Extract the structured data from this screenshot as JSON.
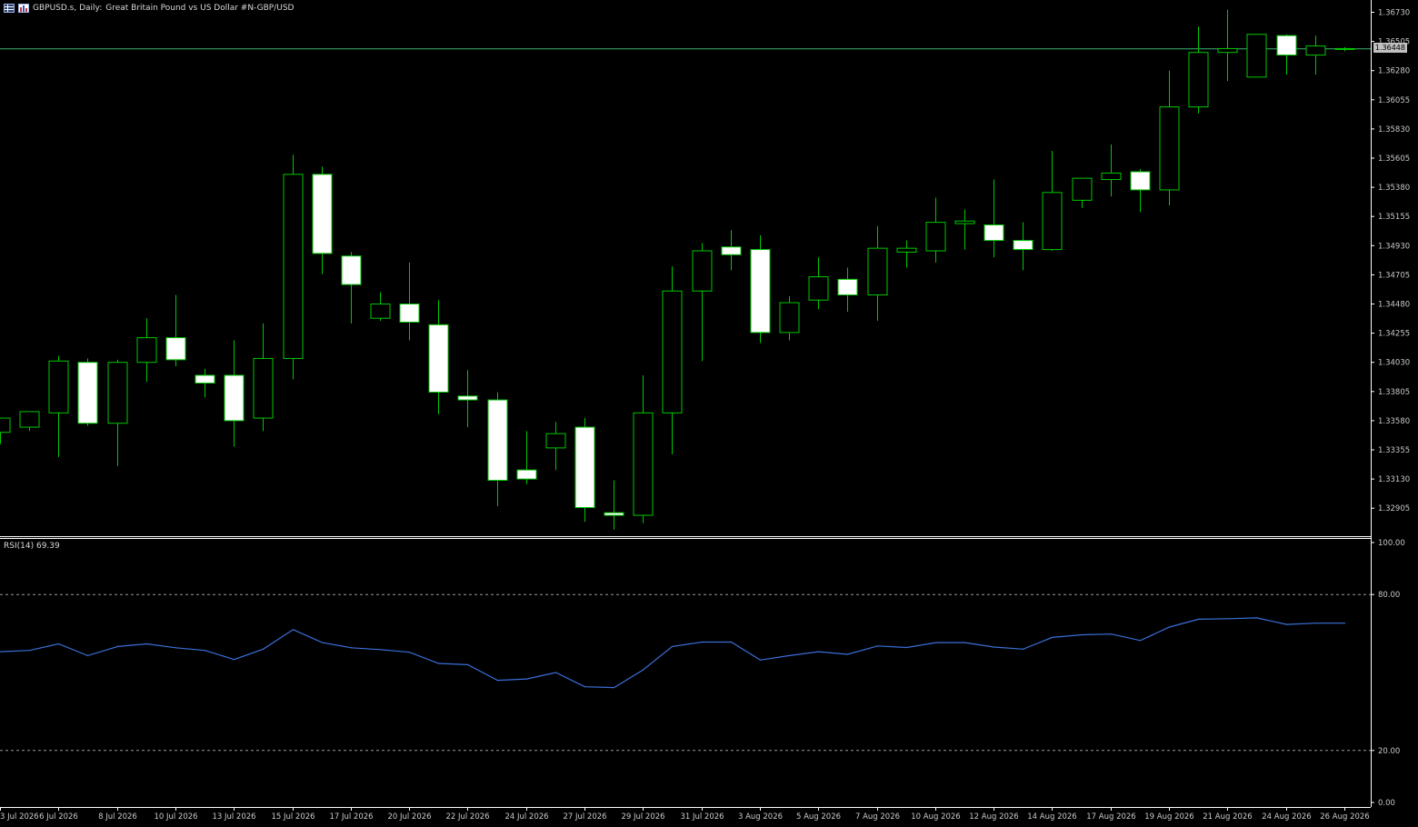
{
  "header": {
    "symbol": "GBPUSD.s, Daily:",
    "description": "Great Britain Pound vs US Dollar #N-GBP/USD",
    "icons": [
      "menu-grid-icon",
      "bar-chart-icon"
    ]
  },
  "rsi_header": {
    "label": "RSI(14)",
    "value": "69.39"
  },
  "current_price_tag": "1.36448",
  "colors": {
    "background": "#000000",
    "candle_outline": "#00c800",
    "bull_body": "#000000",
    "bear_body": "#ffffff",
    "rsi_line": "#3a6fd8",
    "bid_line": "#3cb371",
    "axis": "#ffffff",
    "text": "#c8c8c8"
  },
  "chart_data": [
    {
      "type": "candlestick",
      "title": "GBPUSD.s, Daily:  Great Britain Pound vs US Dollar #N-GBP/USD",
      "price_axis_ticks": [
        "1.36730",
        "1.36505",
        "1.36280",
        "1.36055",
        "1.35830",
        "1.35605",
        "1.35380",
        "1.35155",
        "1.34930",
        "1.34705",
        "1.34480",
        "1.34255",
        "1.34030",
        "1.33805",
        "1.33580",
        "1.33355",
        "1.33130",
        "1.32905"
      ],
      "ylim": [
        1.3275,
        1.368
      ],
      "date_axis_labels": [
        "3 Jul 2026",
        "6 Jul 2026",
        "8 Jul 2026",
        "10 Jul 2026",
        "13 Jul 2026",
        "15 Jul 2026",
        "17 Jul 2026",
        "20 Jul 2026",
        "22 Jul 2026",
        "24 Jul 2026",
        "27 Jul 2026",
        "29 Jul 2026",
        "31 Jul 2026",
        "3 Aug 2026",
        "5 Aug 2026",
        "7 Aug 2026",
        "10 Aug 2026",
        "12 Aug 2026",
        "14 Aug 2026",
        "17 Aug 2026",
        "19 Aug 2026",
        "21 Aug 2026",
        "24 Aug 2026",
        "26 Aug 2026"
      ],
      "bid_line": 1.36448,
      "candles": [
        {
          "o": 1.3349,
          "h": 1.336,
          "l": 1.334,
          "c": 1.336
        },
        {
          "o": 1.3353,
          "h": 1.3365,
          "l": 1.335,
          "c": 1.3365
        },
        {
          "o": 1.3364,
          "h": 1.3408,
          "l": 1.333,
          "c": 1.3404
        },
        {
          "o": 1.3403,
          "h": 1.3406,
          "l": 1.3354,
          "c": 1.3356
        },
        {
          "o": 1.3356,
          "h": 1.3405,
          "l": 1.3323,
          "c": 1.3403
        },
        {
          "o": 1.3403,
          "h": 1.3437,
          "l": 1.3388,
          "c": 1.3422
        },
        {
          "o": 1.3422,
          "h": 1.3455,
          "l": 1.34,
          "c": 1.3405
        },
        {
          "o": 1.3393,
          "h": 1.3398,
          "l": 1.3376,
          "c": 1.3387
        },
        {
          "o": 1.3393,
          "h": 1.342,
          "l": 1.3338,
          "c": 1.3358
        },
        {
          "o": 1.336,
          "h": 1.3433,
          "l": 1.335,
          "c": 1.3406
        },
        {
          "o": 1.3406,
          "h": 1.3563,
          "l": 1.339,
          "c": 1.3548
        },
        {
          "o": 1.3548,
          "h": 1.3554,
          "l": 1.3471,
          "c": 1.3487
        },
        {
          "o": 1.3485,
          "h": 1.3488,
          "l": 1.3433,
          "c": 1.3463
        },
        {
          "o": 1.3437,
          "h": 1.3457,
          "l": 1.3435,
          "c": 1.3448
        },
        {
          "o": 1.3448,
          "h": 1.348,
          "l": 1.342,
          "c": 1.3434
        },
        {
          "o": 1.3432,
          "h": 1.3451,
          "l": 1.3363,
          "c": 1.338
        },
        {
          "o": 1.3377,
          "h": 1.3397,
          "l": 1.3353,
          "c": 1.3374
        },
        {
          "o": 1.3374,
          "h": 1.338,
          "l": 1.3292,
          "c": 1.3312
        },
        {
          "o": 1.332,
          "h": 1.335,
          "l": 1.3309,
          "c": 1.3313
        },
        {
          "o": 1.3337,
          "h": 1.3357,
          "l": 1.332,
          "c": 1.3348
        },
        {
          "o": 1.3353,
          "h": 1.336,
          "l": 1.328,
          "c": 1.3291
        },
        {
          "o": 1.3287,
          "h": 1.3312,
          "l": 1.3274,
          "c": 1.3285
        },
        {
          "o": 1.3285,
          "h": 1.3393,
          "l": 1.3279,
          "c": 1.3364
        },
        {
          "o": 1.3364,
          "h": 1.3477,
          "l": 1.3332,
          "c": 1.3458
        },
        {
          "o": 1.3458,
          "h": 1.3495,
          "l": 1.3404,
          "c": 1.3489
        },
        {
          "o": 1.3492,
          "h": 1.3505,
          "l": 1.3474,
          "c": 1.3486
        },
        {
          "o": 1.349,
          "h": 1.3501,
          "l": 1.3418,
          "c": 1.3426
        },
        {
          "o": 1.3426,
          "h": 1.3454,
          "l": 1.342,
          "c": 1.3449
        },
        {
          "o": 1.3451,
          "h": 1.3484,
          "l": 1.3444,
          "c": 1.3469
        },
        {
          "o": 1.3467,
          "h": 1.3476,
          "l": 1.3442,
          "c": 1.3455
        },
        {
          "o": 1.3455,
          "h": 1.3508,
          "l": 1.3435,
          "c": 1.3491
        },
        {
          "o": 1.3488,
          "h": 1.3497,
          "l": 1.3476,
          "c": 1.3491
        },
        {
          "o": 1.3489,
          "h": 1.353,
          "l": 1.348,
          "c": 1.3511
        },
        {
          "o": 1.351,
          "h": 1.3521,
          "l": 1.349,
          "c": 1.3512
        },
        {
          "o": 1.3509,
          "h": 1.3544,
          "l": 1.3484,
          "c": 1.3497
        },
        {
          "o": 1.3497,
          "h": 1.3511,
          "l": 1.3474,
          "c": 1.349
        },
        {
          "o": 1.349,
          "h": 1.3566,
          "l": 1.3489,
          "c": 1.3534
        },
        {
          "o": 1.3528,
          "h": 1.3545,
          "l": 1.3522,
          "c": 1.3545
        },
        {
          "o": 1.3544,
          "h": 1.3571,
          "l": 1.3531,
          "c": 1.3549
        },
        {
          "o": 1.355,
          "h": 1.3552,
          "l": 1.3519,
          "c": 1.3536
        },
        {
          "o": 1.3536,
          "h": 1.3628,
          "l": 1.3524,
          "c": 1.36
        },
        {
          "o": 1.36,
          "h": 1.3662,
          "l": 1.3595,
          "c": 1.3642
        },
        {
          "o": 1.3642,
          "h": 1.3675,
          "l": 1.362,
          "c": 1.3645
        },
        {
          "o": 1.3623,
          "h": 1.3656,
          "l": 1.3623,
          "c": 1.3656
        },
        {
          "o": 1.3655,
          "h": 1.3656,
          "l": 1.3625,
          "c": 1.364
        },
        {
          "o": 1.364,
          "h": 1.3655,
          "l": 1.3625,
          "c": 1.3647
        },
        {
          "o": 1.3645,
          "h": 1.3646,
          "l": 1.3643,
          "c": 1.3645
        }
      ]
    },
    {
      "type": "line",
      "title": "RSI(14) 69.39",
      "ylim": [
        0,
        100
      ],
      "levels": [
        20,
        80
      ],
      "y_axis_ticks": [
        "100.00",
        "80.00",
        "20.00",
        "0.00"
      ],
      "series": [
        {
          "name": "RSI(14)",
          "values": [
            58.0,
            58.5,
            61.0,
            56.5,
            60.0,
            61.0,
            59.5,
            58.5,
            55.0,
            59.0,
            66.5,
            61.5,
            59.5,
            58.8,
            57.8,
            53.5,
            53.0,
            47.0,
            47.5,
            50.0,
            44.5,
            44.2,
            51.0,
            60.0,
            61.7,
            61.7,
            54.8,
            56.5,
            58.0,
            57.0,
            60.2,
            59.6,
            61.5,
            61.5,
            59.8,
            59.0,
            63.5,
            64.5,
            64.8,
            62.3,
            67.5,
            70.5,
            70.7,
            71.0,
            68.5,
            69.0,
            69.0
          ]
        }
      ]
    }
  ]
}
